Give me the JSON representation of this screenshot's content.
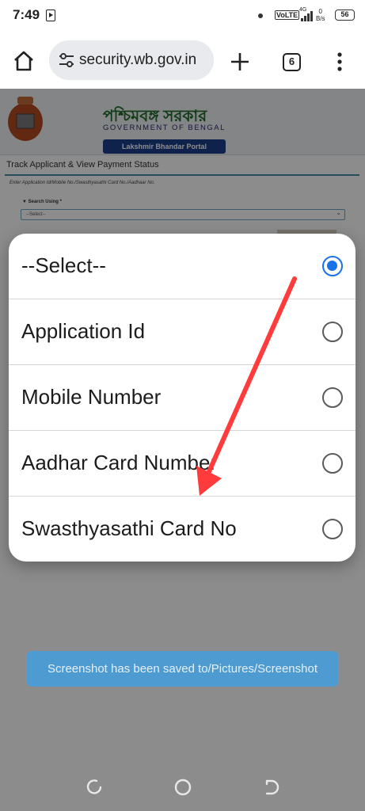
{
  "status_bar": {
    "time": "7:49",
    "volte": "VoLTE",
    "network": "4G",
    "speed_value": "0",
    "speed_unit": "B/s",
    "battery": "56"
  },
  "browser": {
    "url": "security.wb.gov.in",
    "tab_count": "6"
  },
  "webpage": {
    "banner_title": "পশ্চিমবঙ্গ সরকার",
    "banner_subtitle": "GOVERNMENT OF BENGAL",
    "portal_label": "Lakshmir Bhandar Portal",
    "track_title": "Track Applicant & View Payment Status",
    "enter_hint": "Enter Application Id/Mobile No./Swasthyasathi Card No./Aadhaar No.",
    "search_label": "Search Using *",
    "select_value": "--Select--"
  },
  "dialog": {
    "options": [
      {
        "label": "--Select--",
        "selected": true
      },
      {
        "label": "Application Id",
        "selected": false
      },
      {
        "label": "Mobile Number",
        "selected": false
      },
      {
        "label": "Aadhar Card Number",
        "selected": false
      },
      {
        "label": "Swasthyasathi Card No",
        "selected": false
      }
    ]
  },
  "toast": {
    "text": "Screenshot has been saved to/Pictures/Screenshot"
  },
  "colors": {
    "accent": "#1a73e8",
    "arrow": "#ff3b3b",
    "toast": "#4e9bd1",
    "portal": "#1d3f8a"
  }
}
